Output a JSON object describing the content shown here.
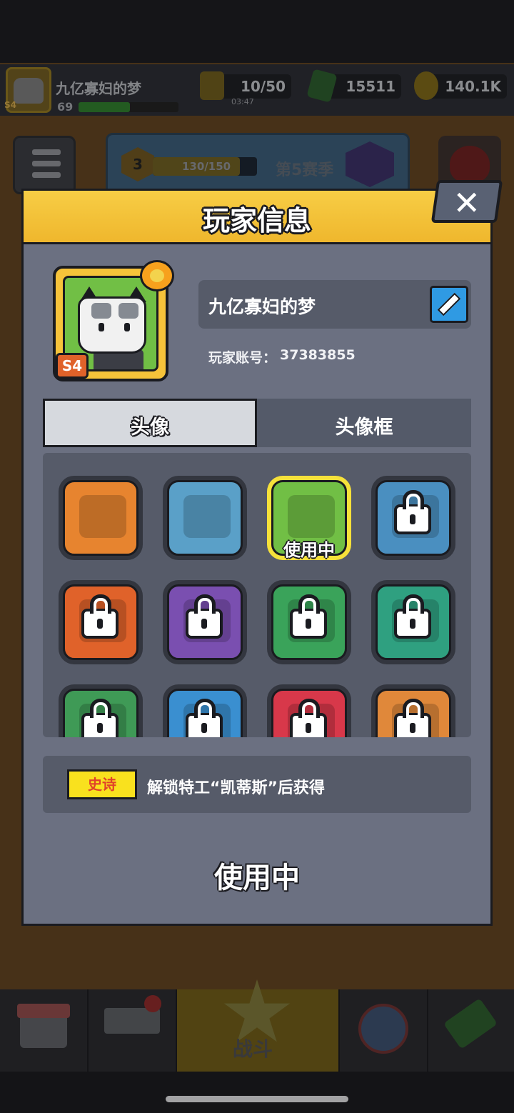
{
  "hud": {
    "player_name": "九亿寡妇的梦",
    "player_level": "69",
    "season_badge": "S4",
    "energy": "10/50",
    "energy_timer": "03:47",
    "gems": "15511",
    "coins": "140.1K",
    "season_level": "3",
    "season_progress": "130/150",
    "season_title": "第5赛季"
  },
  "nav": {
    "battle_label": "战斗"
  },
  "modal": {
    "title": "玩家信息",
    "close_label": "✕",
    "player": {
      "name": "九亿寡妇的梦",
      "badge": "S4",
      "account_label": "玩家账号：",
      "account_id": "37383855"
    },
    "tabs": [
      {
        "label": "头像",
        "active": true
      },
      {
        "label": "头像框",
        "active": false
      }
    ],
    "avatars": [
      {
        "id": "goggles",
        "color": "#e7842f",
        "locked": false,
        "in_use": false
      },
      {
        "id": "zombie-agent",
        "color": "#5aa0c8",
        "locked": false,
        "in_use": false
      },
      {
        "id": "cat",
        "color": "#71bf45",
        "locked": false,
        "in_use": true,
        "in_use_label": "使用中"
      },
      {
        "id": "beast",
        "color": "#4a8fc0",
        "locked": true,
        "in_use": false
      },
      {
        "id": "soldier",
        "color": "#e0622a",
        "locked": true,
        "in_use": false
      },
      {
        "id": "purple-hunter",
        "color": "#7a4fb0",
        "locked": true,
        "in_use": false
      },
      {
        "id": "purple-cat",
        "color": "#3aa35a",
        "locked": true,
        "in_use": false
      },
      {
        "id": "flower",
        "color": "#2fa080",
        "locked": true,
        "in_use": false
      },
      {
        "id": "pirate",
        "color": "#3f9a56",
        "locked": true,
        "in_use": false
      },
      {
        "id": "captain",
        "color": "#3a8fd0",
        "locked": true,
        "in_use": false
      },
      {
        "id": "red-hood",
        "color": "#d8384a",
        "locked": true,
        "in_use": false
      },
      {
        "id": "hooded",
        "color": "#e0883a",
        "locked": true,
        "in_use": false
      }
    ],
    "rarity_label": "史诗",
    "unlock_text": "解锁特工“凯蒂斯”后获得",
    "status_label": "使用中"
  }
}
